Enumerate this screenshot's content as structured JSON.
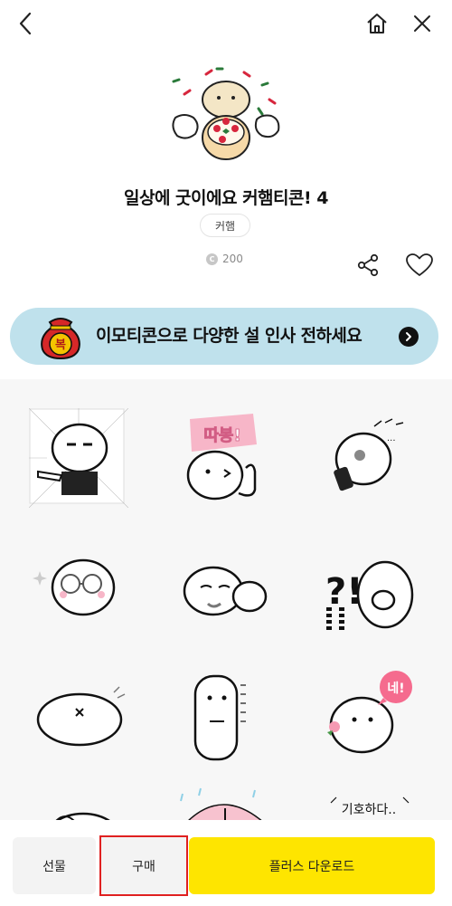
{
  "header": {
    "back_icon": "chevron-left-icon",
    "home_icon": "home-icon",
    "close_icon": "close-icon"
  },
  "product": {
    "title": "일상에 굿이에요 커햄티콘! 4",
    "author": "커햄",
    "price": "200",
    "price_icon": "coin-icon",
    "share_icon": "share-icon",
    "like_icon": "heart-icon"
  },
  "banner": {
    "text": "이모티콘으로 다양한 설 인사 전하세요",
    "bag_label": "복",
    "bag_icon": "lucky-bag-icon",
    "arrow_icon": "chevron-right-icon",
    "color": "#bfe1ec"
  },
  "stickers": {
    "row4_bubble_text": "네!",
    "row5_caption_text": "기호하다.."
  },
  "footer": {
    "gift_label": "선물",
    "buy_label": "구매",
    "plus_label": "플러스 다운로드",
    "plus_color": "#fee500",
    "highlight_color": "#e02020"
  }
}
